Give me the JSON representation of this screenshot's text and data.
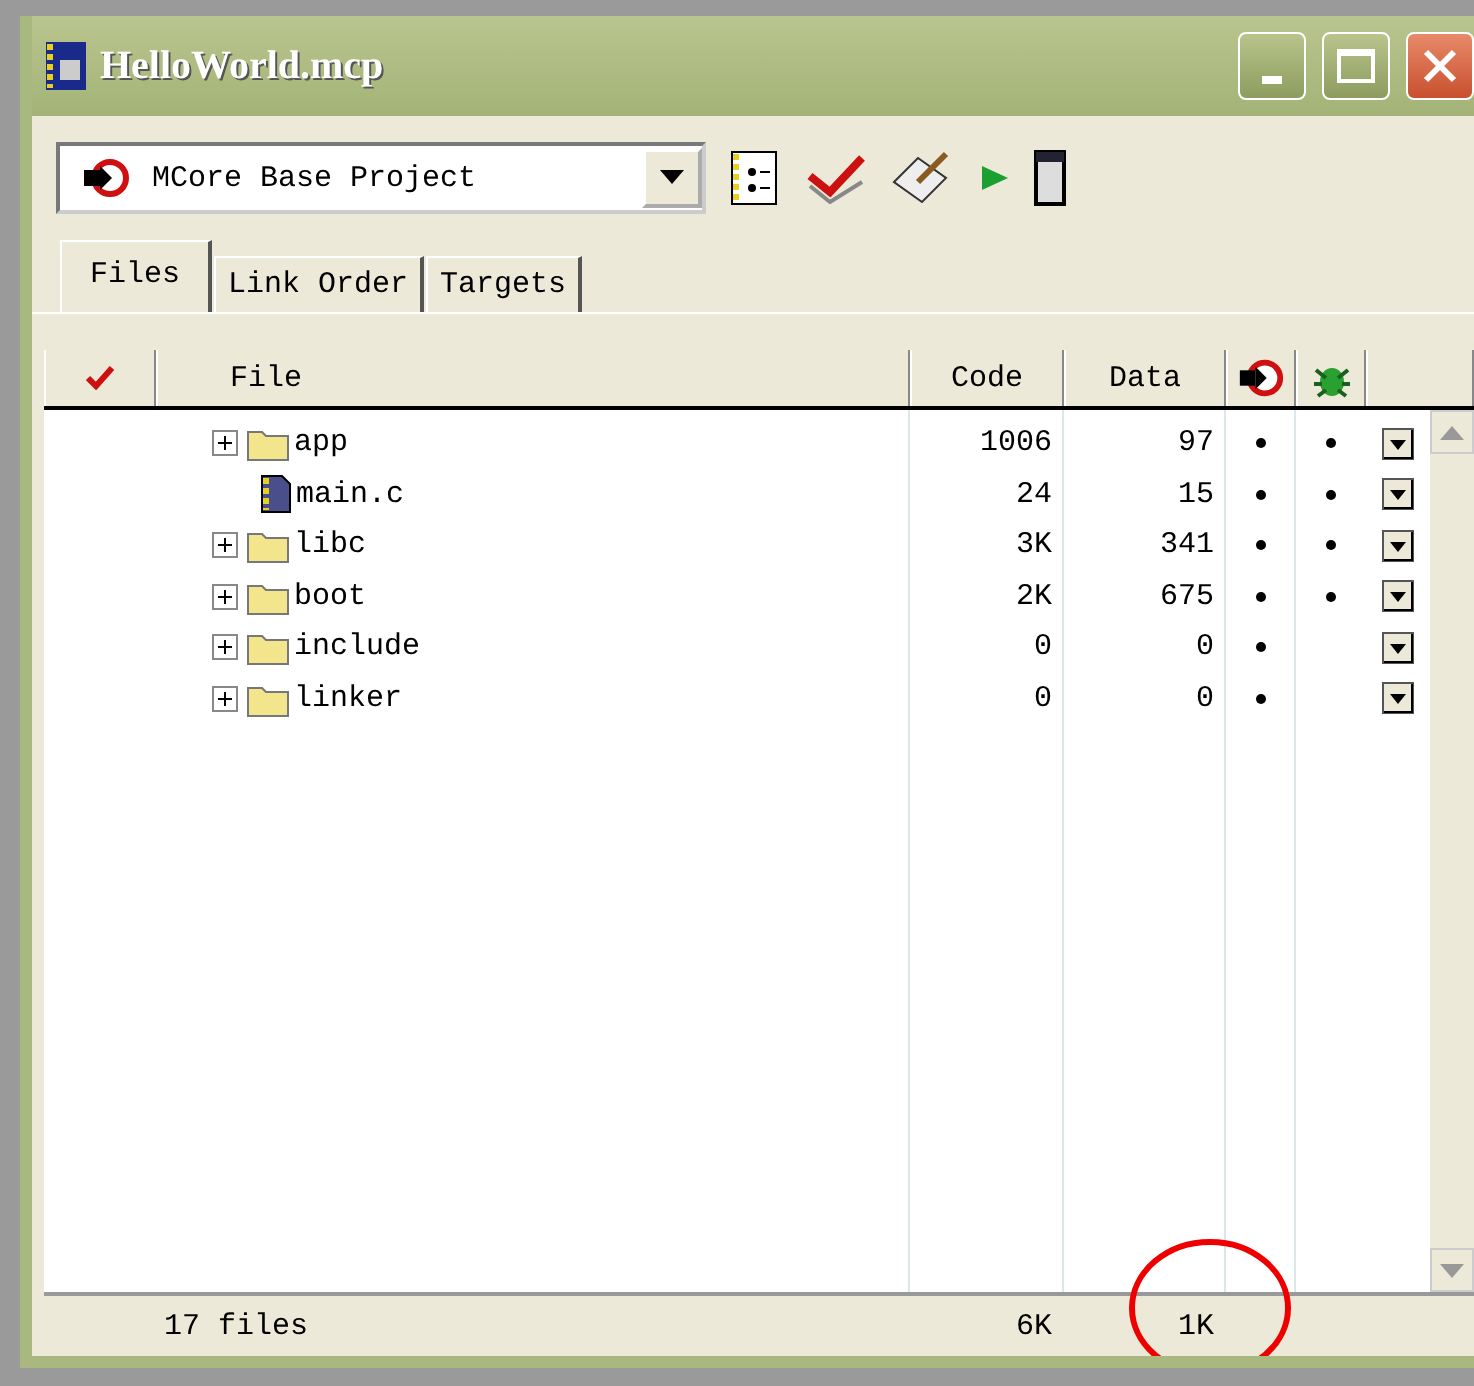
{
  "window": {
    "title": "HelloWorld.mcp"
  },
  "toolbar": {
    "target": "MCore Base Project"
  },
  "tabs": [
    {
      "label": "Files",
      "selected": true
    },
    {
      "label": "Link Order",
      "selected": false
    },
    {
      "label": "Targets",
      "selected": false
    }
  ],
  "table": {
    "columns": [
      "File",
      "Code",
      "Data"
    ],
    "rows": [
      {
        "kind": "folder",
        "name": "app",
        "expanded": false,
        "code": "1006",
        "data": "97",
        "make": true,
        "debug": true
      },
      {
        "kind": "file",
        "name": "main.c",
        "code": "24",
        "data": "15",
        "make": true,
        "debug": true
      },
      {
        "kind": "folder",
        "name": "libc",
        "expanded": false,
        "code": "3K",
        "data": "341",
        "make": true,
        "debug": true
      },
      {
        "kind": "folder",
        "name": "boot",
        "expanded": false,
        "code": "2K",
        "data": "675",
        "make": true,
        "debug": true
      },
      {
        "kind": "folder",
        "name": "include",
        "expanded": false,
        "code": "0",
        "data": "0",
        "make": true,
        "debug": false
      },
      {
        "kind": "folder",
        "name": "linker",
        "expanded": false,
        "code": "0",
        "data": "0",
        "make": true,
        "debug": false
      }
    ]
  },
  "status_bar": {
    "files": "17 files",
    "code": "6K",
    "data": "1K"
  }
}
